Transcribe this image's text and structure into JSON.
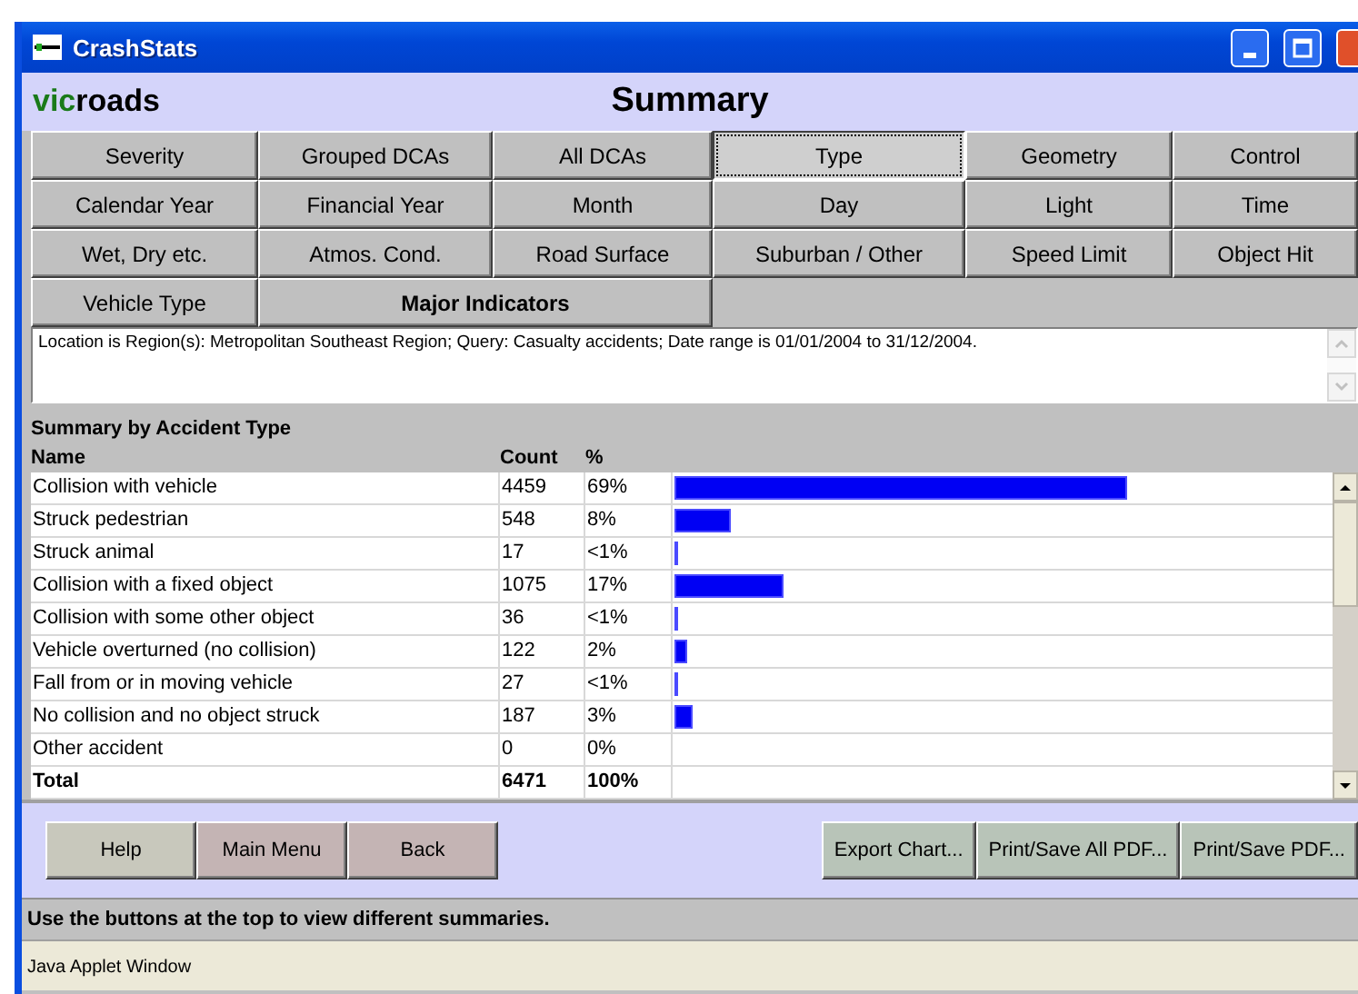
{
  "window": {
    "title": "CrashStats"
  },
  "header": {
    "logo_prefix": "vic",
    "logo_suffix": "roads",
    "title": "Summary"
  },
  "summary_buttons": [
    [
      {
        "label": "Severity",
        "kind": "standard",
        "selected": false
      },
      {
        "label": "Grouped DCAs",
        "kind": "standard",
        "selected": false
      },
      {
        "label": "All DCAs",
        "kind": "standard",
        "selected": false
      },
      {
        "label": "Type",
        "kind": "standard",
        "selected": true
      },
      {
        "label": "Geometry",
        "kind": "standard",
        "selected": false
      },
      {
        "label": "Control",
        "kind": "standard",
        "selected": false
      }
    ],
    [
      {
        "label": "Calendar Year",
        "kind": "standard",
        "selected": false
      },
      {
        "label": "Financial Year",
        "kind": "standard",
        "selected": false
      },
      {
        "label": "Month",
        "kind": "standard",
        "selected": false
      },
      {
        "label": "Day",
        "kind": "standard",
        "selected": false
      },
      {
        "label": "Light",
        "kind": "standard",
        "selected": false
      },
      {
        "label": "Time",
        "kind": "standard",
        "selected": false
      }
    ],
    [
      {
        "label": "Wet, Dry etc.",
        "kind": "standard",
        "selected": false
      },
      {
        "label": "Atmos. Cond.",
        "kind": "standard",
        "selected": false
      },
      {
        "label": "Road Surface",
        "kind": "standard",
        "selected": false
      },
      {
        "label": "Suburban / Other",
        "kind": "standard",
        "selected": false
      },
      {
        "label": "Speed Limit",
        "kind": "standard",
        "selected": false
      },
      {
        "label": "Object Hit",
        "kind": "standard",
        "selected": false
      }
    ],
    [
      {
        "label": "Vehicle Type",
        "kind": "standard",
        "selected": false
      },
      {
        "label": "Major Indicators",
        "kind": "emphasis",
        "selected": false
      }
    ]
  ],
  "query_text": "Location is Region(s): Metropolitan Southeast Region; Query: Casualty accidents; Date range is 01/01/2004 to 31/12/2004.",
  "table": {
    "title": "Summary by Accident Type",
    "columns": [
      "Name",
      "Count",
      "%"
    ],
    "rows": [
      {
        "name": "Collision with vehicle",
        "count": "4459",
        "percent": "69%"
      },
      {
        "name": "Struck pedestrian",
        "count": "548",
        "percent": "8%"
      },
      {
        "name": "Struck animal",
        "count": "17",
        "percent": "<1%"
      },
      {
        "name": "Collision with a fixed object",
        "count": "1075",
        "percent": "17%"
      },
      {
        "name": "Collision with some other object",
        "count": "36",
        "percent": "<1%"
      },
      {
        "name": "Vehicle overturned (no collision)",
        "count": "122",
        "percent": "2%"
      },
      {
        "name": "Fall from or in moving vehicle",
        "count": "27",
        "percent": "<1%"
      },
      {
        "name": "No collision and no object struck",
        "count": "187",
        "percent": "3%"
      },
      {
        "name": "Other accident",
        "count": "0",
        "percent": "0%"
      }
    ],
    "total": {
      "name": "Total",
      "count": "6471",
      "percent": "100%"
    }
  },
  "buttons_left": [
    {
      "label": "Help",
      "color": "#c8c8bc"
    },
    {
      "label": "Main Menu",
      "color": "#c4b4b4"
    },
    {
      "label": "Back",
      "color": "#c4b4b4"
    }
  ],
  "buttons_right": [
    {
      "label": "Export Chart...",
      "color": "#b8c4b8"
    },
    {
      "label": "Print/Save All PDF...",
      "color": "#b8c4b8"
    },
    {
      "label": "Print/Save PDF...",
      "color": "#b8c4b8"
    }
  ],
  "status": "Use the buttons at the top to view different summaries.",
  "applet_bar": "Java Applet Window"
}
